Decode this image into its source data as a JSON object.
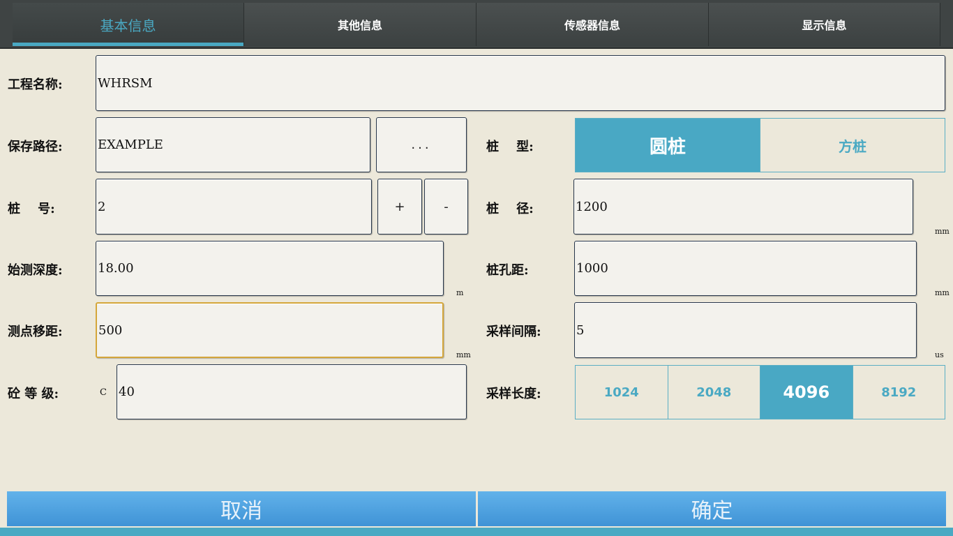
{
  "tabs": [
    {
      "label": "基本信息",
      "active": true
    },
    {
      "label": "其他信息",
      "active": false
    },
    {
      "label": "传感器信息",
      "active": false
    },
    {
      "label": "显示信息",
      "active": false
    }
  ],
  "form": {
    "project_name": {
      "label": "工程名称:",
      "value": "WHRSM"
    },
    "save_path": {
      "label": "保存路径:",
      "value": "EXAMPLE",
      "browse_label": "..."
    },
    "pile_no": {
      "label": "桩    号:",
      "value": "2",
      "plus_label": "+",
      "minus_label": "-"
    },
    "start_depth": {
      "label": "始测深度:",
      "value": "18.00",
      "unit": "m"
    },
    "point_offset": {
      "label": "测点移距:",
      "value": "500",
      "unit": "mm"
    },
    "concrete_grade": {
      "label": "砼 等 级:",
      "prefix": "C",
      "value": "40"
    },
    "pile_type": {
      "label": "桩    型:",
      "options": [
        "圆桩",
        "方桩"
      ],
      "selected": "圆桩"
    },
    "pile_diameter": {
      "label": "桩    径:",
      "value": "1200",
      "unit": "mm"
    },
    "hole_spacing": {
      "label": "桩孔距:",
      "value": "1000",
      "unit": "mm"
    },
    "sample_interval": {
      "label": "采样间隔:",
      "value": "5",
      "unit": "us"
    },
    "sample_length": {
      "label": "采样长度:",
      "options": [
        "1024",
        "2048",
        "4096",
        "8192"
      ],
      "selected": "4096"
    }
  },
  "actions": {
    "cancel": "取消",
    "confirm": "确定"
  },
  "colors": {
    "accent": "#4aa9c3",
    "background": "#ece8da",
    "tab_bar": "#3f4444",
    "action_button": "#4f9fde",
    "focus_border": "#d4a63a"
  }
}
